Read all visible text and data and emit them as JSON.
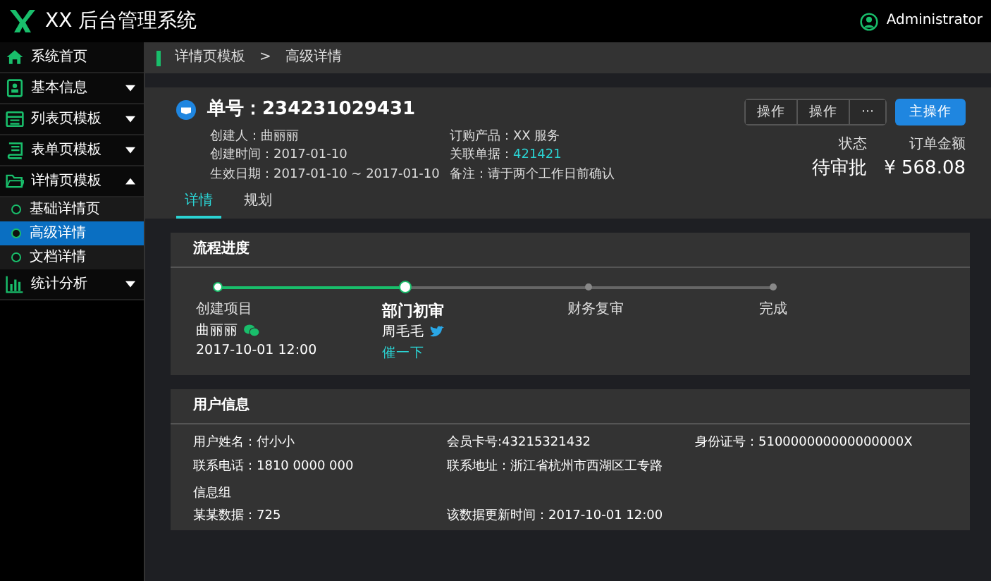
{
  "app": {
    "title": "XX 后台管理系统",
    "user": "Administrator"
  },
  "sidebar": {
    "items": [
      {
        "label": "系统首页",
        "kind": "link"
      },
      {
        "label": "基本信息",
        "kind": "group",
        "expanded": false
      },
      {
        "label": "列表页模板",
        "kind": "group",
        "expanded": false
      },
      {
        "label": "表单页模板",
        "kind": "group",
        "expanded": false
      },
      {
        "label": "详情页模板",
        "kind": "group",
        "expanded": true,
        "children": [
          {
            "label": "基础详情页",
            "selected": false
          },
          {
            "label": "高级详情",
            "selected": true
          },
          {
            "label": "文档详情",
            "selected": false
          }
        ]
      },
      {
        "label": "统计分析",
        "kind": "group",
        "expanded": false
      }
    ]
  },
  "breadcrumb": [
    "详情页模板",
    ">",
    "高级详情"
  ],
  "order": {
    "title": "单号：234231029431",
    "meta": [
      {
        "label": "创建人：",
        "value": "曲丽丽"
      },
      {
        "label": "订购产品：",
        "value": "XX 服务"
      },
      {
        "label": "创建时间：",
        "value": "2017-01-10"
      },
      {
        "label": "关联单据：",
        "value": "421421",
        "link": true
      },
      {
        "label": "生效日期：",
        "value": "2017-01-10 ~ 2017-01-10"
      },
      {
        "label": "备注：",
        "value": "请于两个工作日前确认"
      }
    ],
    "buttons": [
      {
        "label": "操作",
        "kind": "plain"
      },
      {
        "label": "操作",
        "kind": "plain"
      },
      {
        "label": "···",
        "kind": "plain"
      },
      {
        "label": "主操作",
        "kind": "primary"
      }
    ],
    "stats": [
      {
        "label": "状态",
        "value": "待审批"
      },
      {
        "label": "订单金额",
        "value": "¥ 568.08"
      }
    ],
    "tabs": [
      {
        "label": "详情",
        "selected": true
      },
      {
        "label": "规划",
        "selected": false
      }
    ]
  },
  "progress": {
    "title": "流程进度",
    "steps": [
      {
        "label": "创建项目",
        "completed": true,
        "active": false,
        "person": "曲丽丽",
        "time": "2017-10-01 12:00"
      },
      {
        "label": "部门初审",
        "completed": false,
        "active": true,
        "person": "周毛毛",
        "action": "催一下"
      },
      {
        "label": "财务复审",
        "completed": false,
        "active": false
      },
      {
        "label": "完成",
        "completed": false,
        "active": false
      }
    ]
  },
  "user_info": {
    "title": "用户信息",
    "fields": [
      {
        "label": "用户姓名：",
        "value": "付小小"
      },
      {
        "label": "会员卡号:",
        "value": "43215321432"
      },
      {
        "label": "身份证号：",
        "value": "510000000000000000X"
      },
      {
        "label": "联系电话：",
        "value": "1810 0000 000"
      },
      {
        "label": "联系地址：",
        "value": "浙江省杭州市西湖区工专路"
      }
    ],
    "group_title": "信息组",
    "group_fields": [
      {
        "label": "某某数据：",
        "value": "725"
      },
      {
        "label": "该数据更新时间：",
        "value": "2017-10-01 12:00"
      }
    ]
  }
}
